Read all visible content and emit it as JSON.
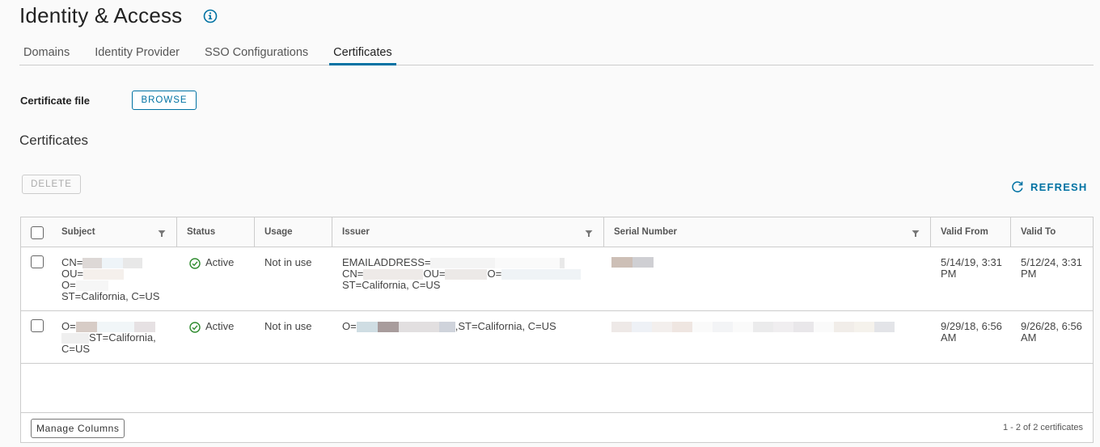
{
  "page": {
    "title": "Identity & Access"
  },
  "tabs": [
    {
      "label": "Domains",
      "active": false
    },
    {
      "label": "Identity Provider",
      "active": false
    },
    {
      "label": "SSO Configurations",
      "active": false
    },
    {
      "label": "Certificates",
      "active": true
    }
  ],
  "upload": {
    "label": "Certificate file",
    "browse_label": "BROWSE"
  },
  "section": {
    "title": "Certificates"
  },
  "actions": {
    "delete_label": "DELETE",
    "refresh_label": "REFRESH"
  },
  "columns": {
    "subject": "Subject",
    "status": "Status",
    "usage": "Usage",
    "issuer": "Issuer",
    "serial": "Serial Number",
    "valid_from": "Valid From",
    "valid_to": "Valid To"
  },
  "rows": [
    {
      "subject_lines": [
        "CN=",
        "OU=",
        "O=",
        "ST=California, C=US"
      ],
      "status": "Active",
      "usage": "Not in use",
      "issuer_lines": [
        "EMAILADDRESS=",
        "CN=",
        "OU=",
        "O=",
        "ST=California, C=US"
      ],
      "valid_from": "5/14/19, 3:31 PM",
      "valid_to": "5/12/24, 3:31 PM"
    },
    {
      "subject_lines": [
        "O=",
        "ST=California,",
        "C=US"
      ],
      "status": "Active",
      "usage": "Not in use",
      "issuer_lines": [
        "O=",
        ",ST=California, C=US"
      ],
      "valid_from": "9/29/18, 6:56 AM",
      "valid_to": "9/26/28, 6:56 AM"
    }
  ],
  "footer": {
    "manage_columns_label": "Manage Columns",
    "pager": "1 - 2 of 2 certificates"
  },
  "colors": {
    "accent": "#0072a3",
    "success": "#2e8b2e",
    "border": "#cccccc"
  }
}
